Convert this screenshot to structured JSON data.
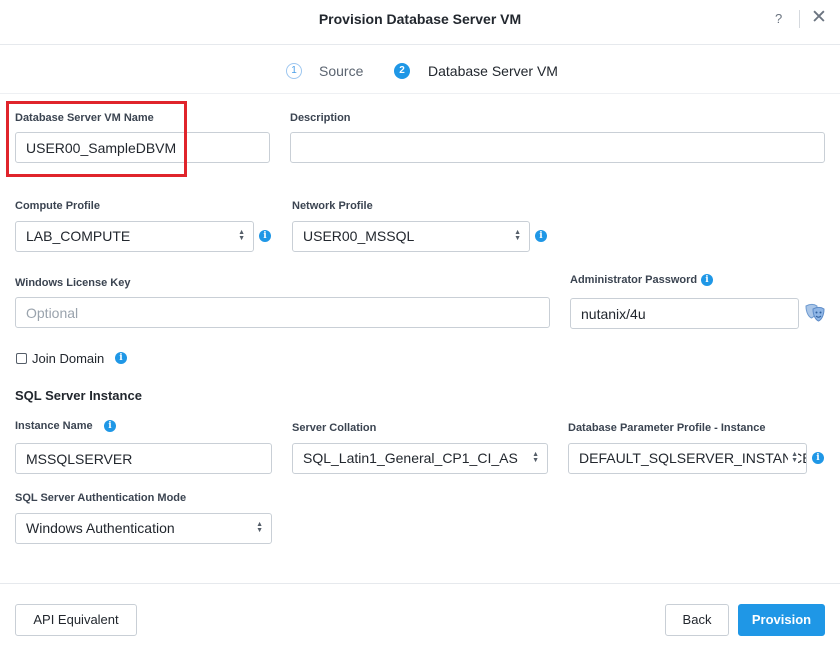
{
  "dialog": {
    "title": "Provision Database Server VM",
    "help_label": "?",
    "close_label": "✕"
  },
  "steps": [
    {
      "number": "1",
      "label": "Source"
    },
    {
      "number": "2",
      "label": "Database Server VM"
    }
  ],
  "form": {
    "vm_name": {
      "label": "Database Server VM Name",
      "value": "USER00_SampleDBVM"
    },
    "description": {
      "label": "Description",
      "value": ""
    },
    "compute_profile": {
      "label": "Compute Profile",
      "value": "LAB_COMPUTE"
    },
    "network_profile": {
      "label": "Network Profile",
      "value": "USER00_MSSQL"
    },
    "license_key": {
      "label": "Windows License Key",
      "placeholder": "Optional"
    },
    "admin_password": {
      "label": "Administrator Password",
      "value": "nutanix/4u"
    },
    "join_domain": {
      "label": "Join Domain",
      "checked": false
    }
  },
  "sql_section": {
    "title": "SQL Server Instance",
    "instance_name": {
      "label": "Instance Name",
      "value": "MSSQLSERVER"
    },
    "server_collation": {
      "label": "Server Collation",
      "value": "SQL_Latin1_General_CP1_CI_AS"
    },
    "param_profile": {
      "label": "Database Parameter Profile - Instance",
      "value": "DEFAULT_SQLSERVER_INSTANCE"
    },
    "auth_mode": {
      "label": "SQL Server Authentication Mode",
      "value": "Windows Authentication"
    }
  },
  "footer": {
    "api_button": "API Equivalent",
    "back_button": "Back",
    "provision_button": "Provision"
  },
  "icons": {
    "info": "i",
    "password_reveal": "mask-icon"
  },
  "colors": {
    "accent": "#1f97e6",
    "highlight": "#e0242b"
  }
}
